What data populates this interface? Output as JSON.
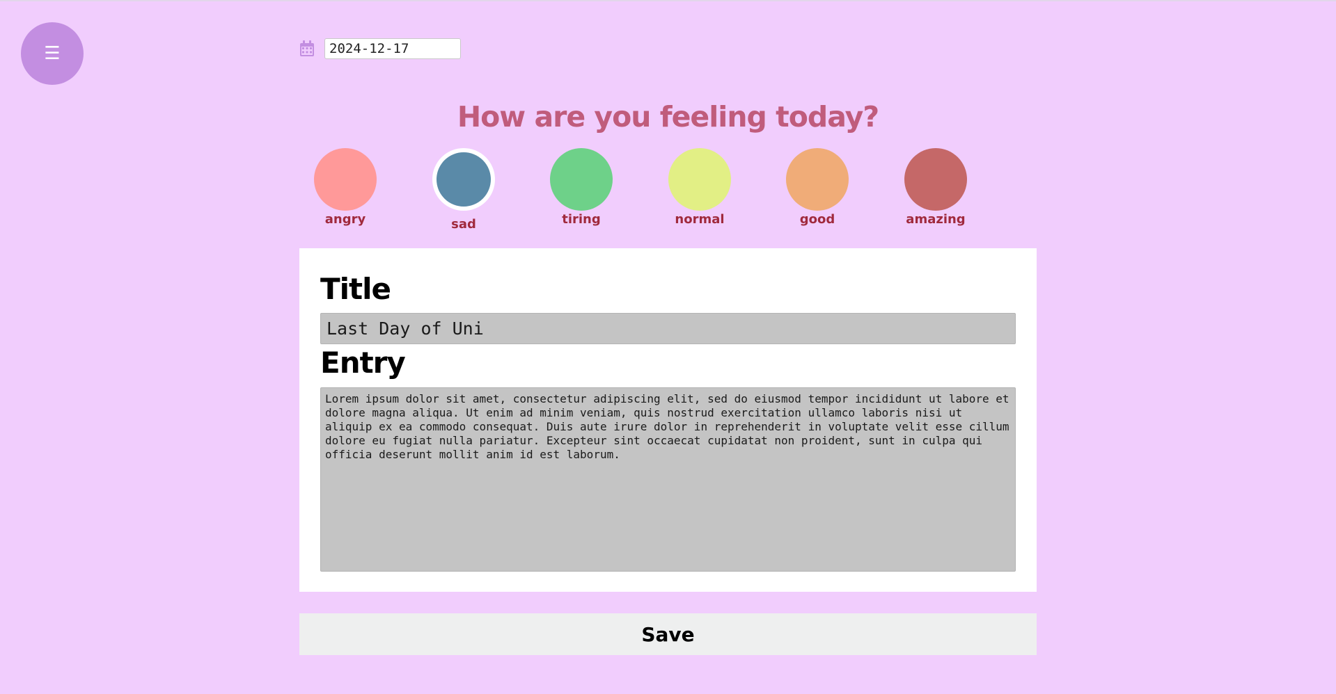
{
  "menu": {
    "icon": "hamburger-menu-icon",
    "glyph": "☰"
  },
  "date": {
    "icon": "calendar-icon",
    "value": "2024-12-17"
  },
  "heading": "How are you feeling today?",
  "moods": [
    {
      "label": "angry",
      "color": "#ff9999",
      "selected": false
    },
    {
      "label": "sad",
      "color": "#5a8aa8",
      "selected": true
    },
    {
      "label": "tiring",
      "color": "#6ed189",
      "selected": false
    },
    {
      "label": "normal",
      "color": "#e2ef85",
      "selected": false
    },
    {
      "label": "good",
      "color": "#f0ac78",
      "selected": false
    },
    {
      "label": "amazing",
      "color": "#c56868",
      "selected": false
    }
  ],
  "form": {
    "title_label": "Title",
    "title_value": "Last Day of Uni",
    "entry_label": "Entry",
    "entry_value": "Lorem ipsum dolor sit amet, consectetur adipiscing elit, sed do eiusmod tempor incididunt ut labore et dolore magna aliqua. Ut enim ad minim veniam, quis nostrud exercitation ullamco laboris nisi ut aliquip ex ea commodo consequat. Duis aute irure dolor in reprehenderit in voluptate velit esse cillum dolore eu fugiat nulla pariatur. Excepteur sint occaecat cupidatat non proident, sunt in culpa qui officia deserunt mollit anim id est laborum."
  },
  "save_label": "Save",
  "colors": {
    "background": "#f1cdfd",
    "menu_button": "#c38ee1",
    "heading": "#c05c7c",
    "mood_label": "#a02a3d"
  }
}
